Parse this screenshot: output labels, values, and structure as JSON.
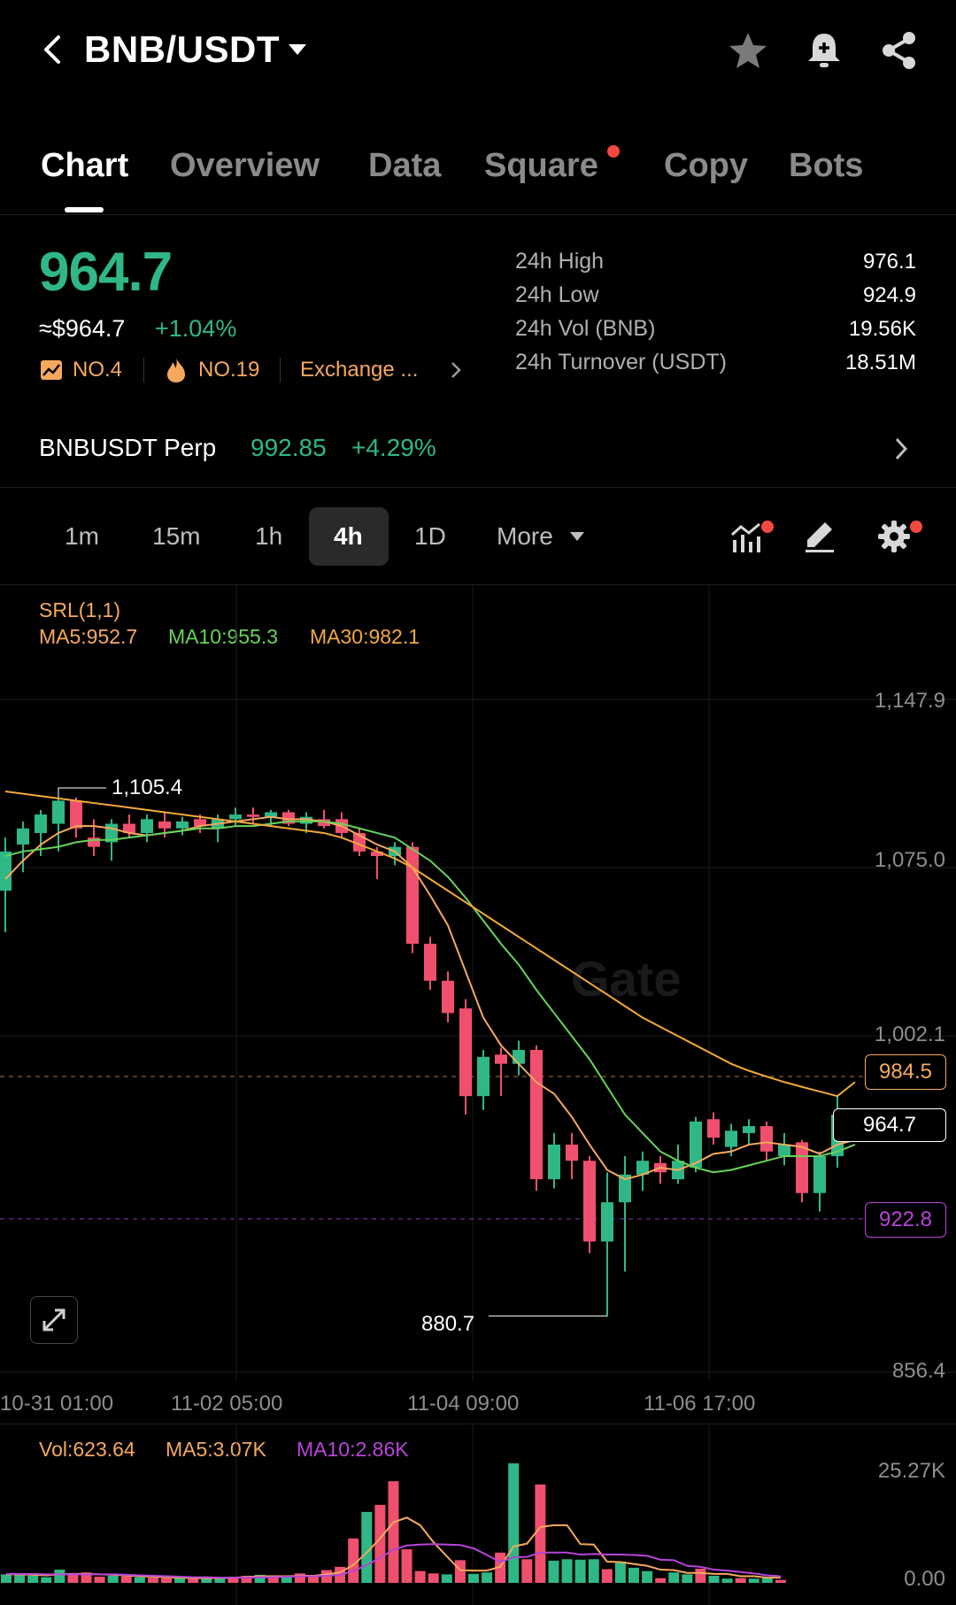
{
  "header": {
    "title": "BNB/USDT"
  },
  "tabs": [
    {
      "label": "Chart",
      "active": true
    },
    {
      "label": "Overview"
    },
    {
      "label": "Data"
    },
    {
      "label": "Square",
      "dot": true
    },
    {
      "label": "Copy"
    },
    {
      "label": "Bots"
    }
  ],
  "price": {
    "last": "964.7",
    "usd": "≈$964.7",
    "change": "+1.04%",
    "rank1": "NO.4",
    "rank2": "NO.19",
    "exchange": "Exchange ..."
  },
  "stats": [
    {
      "label": "24h High",
      "value": "976.1"
    },
    {
      "label": "24h Low",
      "value": "924.9"
    },
    {
      "label": "24h Vol (BNB)",
      "value": "19.56K"
    },
    {
      "label": "24h Turnover (USDT)",
      "value": "18.51M"
    }
  ],
  "perp": {
    "name": "BNBUSDT Perp",
    "price": "992.85",
    "change": "+4.29%"
  },
  "intervals": [
    "1m",
    "15m",
    "1h",
    "4h",
    "1D",
    "More"
  ],
  "active_interval": "4h",
  "indicators": {
    "srl": "SRL(1,1)",
    "ma5": "MA5:952.7",
    "ma10": "MA10:955.3",
    "ma30": "MA30:982.1"
  },
  "volume_legend": {
    "vol": "Vol:623.64",
    "ma5": "MA5:3.07K",
    "ma10": "MA10:2.86K"
  },
  "colors": {
    "up": "#2fb886",
    "down": "#f0506e",
    "ma5": "#f6a95d",
    "ma10": "#67d35a",
    "ma30": "#f3a93a",
    "vol_ma10": "#b545d8"
  },
  "chart_data": {
    "type": "candlestick",
    "y_ticks": [
      "1,147.9",
      "1,075.0",
      "1,002.1",
      "856.4"
    ],
    "y_tick_values": [
      1147.9,
      1075.0,
      1002.1,
      856.4
    ],
    "ylim": [
      856.4,
      1147.9
    ],
    "x_ticks": [
      "10-31 01:00",
      "11-02 05:00",
      "11-04 09:00",
      "11-06 17:00"
    ],
    "high_label": "1,105.4",
    "low_label": "880.7",
    "price_tags": {
      "ma30_line": "984.5",
      "current": "964.7",
      "srl_line": "922.8"
    },
    "price_tag_values": {
      "ma30_line": 984.5,
      "current": 964.7,
      "srl_line": 922.8
    },
    "candles": [
      {
        "o": 1065,
        "h": 1088,
        "l": 1047,
        "c": 1082
      },
      {
        "o": 1085,
        "h": 1095,
        "l": 1073,
        "c": 1092
      },
      {
        "o": 1090,
        "h": 1100,
        "l": 1080,
        "c": 1098
      },
      {
        "o": 1094,
        "h": 1106,
        "l": 1082,
        "c": 1104
      },
      {
        "o": 1104,
        "h": 1105.4,
        "l": 1088,
        "c": 1092
      },
      {
        "o": 1088,
        "h": 1096,
        "l": 1080,
        "c": 1084
      },
      {
        "o": 1086,
        "h": 1096,
        "l": 1078,
        "c": 1094
      },
      {
        "o": 1094,
        "h": 1098,
        "l": 1088,
        "c": 1090
      },
      {
        "o": 1090,
        "h": 1098,
        "l": 1086,
        "c": 1096
      },
      {
        "o": 1095,
        "h": 1099,
        "l": 1088,
        "c": 1092
      },
      {
        "o": 1092,
        "h": 1097,
        "l": 1089,
        "c": 1095
      },
      {
        "o": 1096,
        "h": 1098,
        "l": 1090,
        "c": 1093
      },
      {
        "o": 1092,
        "h": 1098,
        "l": 1086,
        "c": 1096
      },
      {
        "o": 1096,
        "h": 1101,
        "l": 1093,
        "c": 1098
      },
      {
        "o": 1098,
        "h": 1101,
        "l": 1094,
        "c": 1097
      },
      {
        "o": 1097,
        "h": 1100,
        "l": 1093,
        "c": 1099
      },
      {
        "o": 1099,
        "h": 1100,
        "l": 1093,
        "c": 1094
      },
      {
        "o": 1094,
        "h": 1099,
        "l": 1090,
        "c": 1097
      },
      {
        "o": 1096,
        "h": 1100,
        "l": 1092,
        "c": 1093
      },
      {
        "o": 1096,
        "h": 1099,
        "l": 1088,
        "c": 1090
      },
      {
        "o": 1090,
        "h": 1092,
        "l": 1080,
        "c": 1082
      },
      {
        "o": 1082,
        "h": 1084,
        "l": 1070,
        "c": 1080
      },
      {
        "o": 1080,
        "h": 1086,
        "l": 1076,
        "c": 1084
      },
      {
        "o": 1084,
        "h": 1086,
        "l": 1038,
        "c": 1042
      },
      {
        "o": 1042,
        "h": 1045,
        "l": 1022,
        "c": 1026
      },
      {
        "o": 1026,
        "h": 1030,
        "l": 1008,
        "c": 1012
      },
      {
        "o": 1014,
        "h": 1018,
        "l": 968,
        "c": 976
      },
      {
        "o": 976,
        "h": 996,
        "l": 970,
        "c": 993
      },
      {
        "o": 994,
        "h": 997,
        "l": 976,
        "c": 990
      },
      {
        "o": 990,
        "h": 1000,
        "l": 985,
        "c": 996
      },
      {
        "o": 996,
        "h": 998,
        "l": 935,
        "c": 940
      },
      {
        "o": 940,
        "h": 960,
        "l": 936,
        "c": 955
      },
      {
        "o": 955,
        "h": 960,
        "l": 940,
        "c": 948
      },
      {
        "o": 948,
        "h": 950,
        "l": 908,
        "c": 913
      },
      {
        "o": 913,
        "h": 943,
        "l": 880.7,
        "c": 930
      },
      {
        "o": 930,
        "h": 950,
        "l": 900,
        "c": 942
      },
      {
        "o": 942,
        "h": 952,
        "l": 935,
        "c": 948
      },
      {
        "o": 947,
        "h": 950,
        "l": 938,
        "c": 943
      },
      {
        "o": 940,
        "h": 955,
        "l": 938,
        "c": 948
      },
      {
        "o": 945,
        "h": 967,
        "l": 943,
        "c": 965
      },
      {
        "o": 966,
        "h": 969,
        "l": 955,
        "c": 958
      },
      {
        "o": 954,
        "h": 964,
        "l": 950,
        "c": 961
      },
      {
        "o": 960,
        "h": 966,
        "l": 955,
        "c": 963
      },
      {
        "o": 963,
        "h": 965,
        "l": 948,
        "c": 952
      },
      {
        "o": 950,
        "h": 960,
        "l": 946,
        "c": 955
      },
      {
        "o": 956,
        "h": 957,
        "l": 930,
        "c": 934
      },
      {
        "o": 934,
        "h": 952,
        "l": 926,
        "c": 950
      },
      {
        "o": 950,
        "h": 976,
        "l": 945,
        "c": 968
      },
      {
        "o": 968,
        "h": 970,
        "l": 960,
        "c": 964.7
      }
    ],
    "series": [
      {
        "name": "MA5",
        "values": [
          1070,
          1078,
          1085,
          1090,
          1093,
          1093,
          1092,
          1090,
          1089,
          1090,
          1091,
          1093,
          1094,
          1095,
          1096,
          1097,
          1096,
          1096,
          1095,
          1093,
          1089,
          1085,
          1082,
          1075,
          1063,
          1050,
          1030,
          1010,
          998,
          990,
          982,
          977,
          967,
          955,
          944,
          940,
          942,
          945,
          944,
          947,
          951,
          952,
          955,
          956,
          955,
          954,
          951,
          955,
          957
        ]
      },
      {
        "name": "MA10",
        "values": [
          1080,
          1082,
          1083,
          1084,
          1086,
          1087,
          1087,
          1088,
          1089,
          1090,
          1091,
          1092,
          1092,
          1093,
          1093,
          1094,
          1095,
          1095,
          1095,
          1094,
          1092,
          1090,
          1088,
          1083,
          1078,
          1071,
          1062,
          1052,
          1042,
          1033,
          1022,
          1012,
          1002,
          992,
          980,
          968,
          960,
          952,
          948,
          945,
          943,
          944,
          946,
          948,
          950,
          950,
          950,
          952,
          955
        ]
      },
      {
        "name": "MA30",
        "values": [
          1108,
          1107,
          1106,
          1105,
          1104,
          1103,
          1102,
          1101,
          1100,
          1099,
          1098,
          1097,
          1096,
          1095,
          1094,
          1093,
          1092,
          1091,
          1090,
          1088,
          1085,
          1082,
          1079,
          1075,
          1070,
          1065,
          1060,
          1055,
          1050,
          1045,
          1040,
          1035,
          1030,
          1025,
          1020,
          1015,
          1010,
          1006,
          1002,
          998,
          994,
          990,
          987,
          984.5,
          982.1,
          980,
          978,
          976,
          982.1
        ]
      }
    ],
    "volume": {
      "ytick_labels": [
        "25.27K",
        "0.00"
      ],
      "ylim": [
        0,
        25270
      ],
      "values": [
        1800,
        2000,
        1500,
        1200,
        2800,
        1800,
        2200,
        1300,
        1500,
        1400,
        1200,
        1100,
        1000,
        1000,
        900,
        1000,
        1200,
        1300,
        1500,
        1700,
        1100,
        1300,
        2000,
        1500,
        2700,
        3400,
        9400,
        15000,
        16500,
        21500,
        7100,
        2500,
        2000,
        1800,
        4800,
        1900,
        2200,
        6400,
        25270,
        5000,
        20800,
        4700,
        5000,
        4900,
        5000,
        2900,
        4500,
        3200,
        2500,
        1000,
        2200,
        1800,
        3000,
        1500,
        900,
        1000,
        900,
        1200,
        623.64
      ],
      "ma5": [
        1800,
        1800,
        1700,
        1600,
        1800,
        1900,
        1900,
        1800,
        1700,
        1600,
        1400,
        1300,
        1200,
        1100,
        1000,
        1000,
        1000,
        1100,
        1200,
        1400,
        1400,
        1400,
        1500,
        1500,
        1800,
        2200,
        3800,
        6400,
        9400,
        12800,
        13800,
        12200,
        8600,
        5600,
        2700,
        2600,
        2600,
        3400,
        7700,
        8300,
        11800,
        12200,
        12200,
        8200,
        8100,
        4500,
        4400,
        4000,
        3600,
        2800,
        2700,
        2100,
        2100,
        1900,
        1900,
        1400,
        1400,
        1100,
        1100
      ],
      "ma10": [
        1900,
        1900,
        1900,
        1800,
        1800,
        1800,
        1800,
        1800,
        1800,
        1700,
        1600,
        1500,
        1400,
        1300,
        1200,
        1200,
        1100,
        1100,
        1100,
        1200,
        1200,
        1300,
        1400,
        1400,
        1500,
        1700,
        2500,
        3800,
        5300,
        7000,
        7900,
        8100,
        8200,
        8100,
        8000,
        7300,
        5900,
        4400,
        5400,
        5500,
        6400,
        6400,
        6400,
        6000,
        6100,
        6000,
        6000,
        5900,
        5700,
        4900,
        4800,
        3600,
        3400,
        2800,
        2600,
        2300,
        2000,
        1600,
        1400
      ]
    }
  }
}
